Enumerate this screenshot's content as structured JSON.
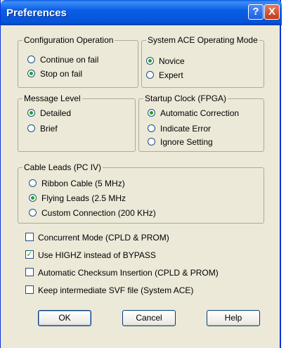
{
  "window": {
    "title": "Preferences",
    "help_glyph": "?",
    "close_glyph": "X"
  },
  "config_op": {
    "legend": "Configuration Operation",
    "options": [
      {
        "label": "Continue on fail",
        "selected": false
      },
      {
        "label": "Stop on fail",
        "selected": true
      }
    ]
  },
  "ace_mode": {
    "legend": "System ACE Operating Mode",
    "options": [
      {
        "label": "Novice",
        "selected": true
      },
      {
        "label": "Expert",
        "selected": false
      }
    ]
  },
  "message_level": {
    "legend": "Message Level",
    "options": [
      {
        "label": "Detailed",
        "selected": true
      },
      {
        "label": "Brief",
        "selected": false
      }
    ]
  },
  "startup_clock": {
    "legend": "Startup Clock (FPGA)",
    "options": [
      {
        "label": "Automatic Correction",
        "selected": true
      },
      {
        "label": "Indicate Error",
        "selected": false
      },
      {
        "label": "Ignore Setting",
        "selected": false
      }
    ]
  },
  "cable_leads": {
    "legend": "Cable Leads (PC IV)",
    "options": [
      {
        "label": "Ribbon Cable (5 MHz)",
        "selected": false
      },
      {
        "label": "Flying Leads (2.5 MHz",
        "selected": true
      },
      {
        "label": "Custom Connection (200 KHz)",
        "selected": false
      }
    ]
  },
  "checkboxes": [
    {
      "label": "Concurrent Mode (CPLD & PROM)",
      "checked": false
    },
    {
      "label": "Use HIGHZ instead of BYPASS",
      "checked": true
    },
    {
      "label": "Automatic Checksum Insertion (CPLD & PROM)",
      "checked": false
    },
    {
      "label": "Keep intermediate SVF file (System ACE)",
      "checked": false
    }
  ],
  "buttons": {
    "ok": "OK",
    "cancel": "Cancel",
    "help": "Help"
  }
}
